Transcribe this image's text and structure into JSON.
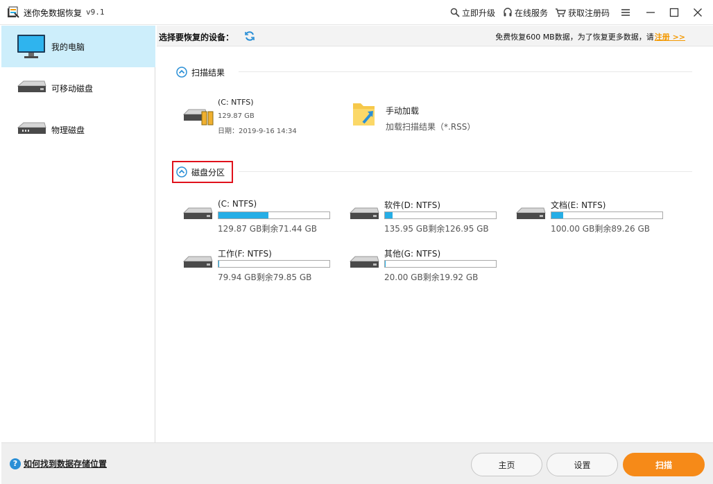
{
  "titlebar": {
    "title": "迷你免数据恢复",
    "version": "v9.1",
    "upgrade": "立即升级",
    "online_service": "在线服务",
    "get_code": "获取注册码"
  },
  "sidebar": {
    "items": [
      {
        "label": "我的电脑"
      },
      {
        "label": "可移动磁盘"
      },
      {
        "label": "物理磁盘"
      }
    ]
  },
  "main": {
    "select_label": "选择要恢复的设备：",
    "promo_text": "免费恢复600 MB数据，为了恢复更多数据，请",
    "promo_link": "注册 >>",
    "scan_results": {
      "title": "扫描结果",
      "item": {
        "name": "(C: NTFS)",
        "size": "129.87 GB",
        "date": "日期：2019-9-16 14:34"
      },
      "manual": {
        "name": "手动加载",
        "desc": "加载扫描结果（*.RSS）"
      }
    },
    "partitions": {
      "title": "磁盘分区",
      "drives": [
        {
          "name": "(C: NTFS)",
          "size": "129.87 GB剩余71.44 GB",
          "used": 0.45
        },
        {
          "name": "软件(D: NTFS)",
          "size": "135.95 GB剩余126.95 GB",
          "used": 0.066
        },
        {
          "name": "文档(E: NTFS)",
          "size": "100.00 GB剩余89.26 GB",
          "used": 0.107
        },
        {
          "name": "工作(F: NTFS)",
          "size": "79.94 GB剩余79.85 GB",
          "used": 0.001
        },
        {
          "name": "其他(G: NTFS)",
          "size": "20.00 GB剩余19.92 GB",
          "used": 0.004
        }
      ]
    }
  },
  "footer": {
    "help": "如何找到数据存储位置",
    "home": "主页",
    "settings": "设置",
    "scan": "扫描"
  },
  "colors": {
    "accent": "#26aee6",
    "orange": "#f68a18",
    "highlight": "#e0111b",
    "sidebar_active": "#cdeefb"
  }
}
